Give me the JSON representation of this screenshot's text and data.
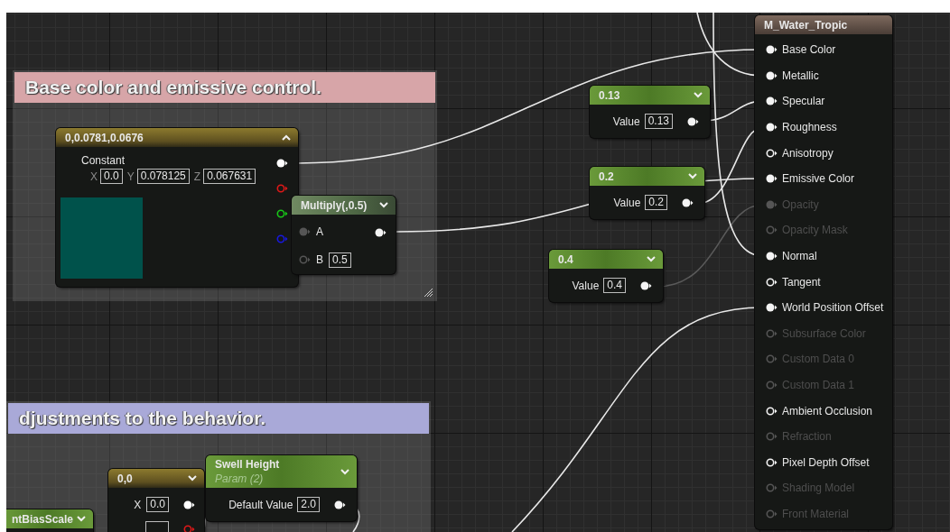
{
  "comments": [
    {
      "title": "Base color and emissive control.",
      "color": "#d7a5a8"
    },
    {
      "title": "djustments to the behavior.",
      "color": "#a9a9d8"
    }
  ],
  "constant": {
    "title": "0,0.0781,0.0676",
    "expanded": true,
    "label": "Constant",
    "fields": [
      {
        "axis": "X",
        "value": "0.0"
      },
      {
        "axis": "Y",
        "value": "0.078125"
      },
      {
        "axis": "Z",
        "value": "0.067631"
      }
    ],
    "color": "#00524b",
    "outputs": [
      {
        "color": "#ffffff",
        "filled": true
      },
      {
        "color": "#e01818",
        "filled": false
      },
      {
        "color": "#18c818",
        "filled": false
      },
      {
        "color": "#1818e0",
        "filled": false
      }
    ]
  },
  "multiply": {
    "title": "Multiply(,0.5)",
    "expanded": false,
    "inputs": [
      {
        "label": "A",
        "filled": true
      },
      {
        "label": "B",
        "value": "0.5",
        "filled": false
      }
    ]
  },
  "scalars": [
    {
      "title": "0.13",
      "expanded": false,
      "label": "Value",
      "value": "0.13"
    },
    {
      "title": "0.2",
      "expanded": false,
      "label": "Value",
      "value": "0.2"
    },
    {
      "title": "0.4",
      "expanded": false,
      "label": "Value",
      "value": "0.4"
    }
  ],
  "vector2": {
    "title": "0,0",
    "expanded": false,
    "rows": [
      {
        "axis": "X",
        "value": "0.0",
        "color": "#ffffff",
        "filled": true
      },
      {
        "color": "#e01818",
        "filled": false
      }
    ]
  },
  "param": {
    "title": "Swell Height",
    "subtitle": "Param (2)",
    "expanded": false,
    "label": "Default Value",
    "value": "2.0"
  },
  "cut_node": {
    "title": "ntBiasScale",
    "expanded": false
  },
  "material": {
    "title": "M_Water_Tropic",
    "inputs": [
      {
        "label": "Base Color",
        "filled": true,
        "disabled": false
      },
      {
        "label": "Metallic",
        "filled": true,
        "disabled": false
      },
      {
        "label": "Specular",
        "filled": true,
        "disabled": false
      },
      {
        "label": "Roughness",
        "filled": true,
        "disabled": false
      },
      {
        "label": "Anisotropy",
        "filled": false,
        "disabled": false
      },
      {
        "label": "Emissive Color",
        "filled": true,
        "disabled": false
      },
      {
        "label": "Opacity",
        "filled": true,
        "disabled": true
      },
      {
        "label": "Opacity Mask",
        "filled": false,
        "disabled": true
      },
      {
        "label": "Normal",
        "filled": true,
        "disabled": false
      },
      {
        "label": "Tangent",
        "filled": false,
        "disabled": false
      },
      {
        "label": "World Position Offset",
        "filled": true,
        "disabled": false
      },
      {
        "label": "Subsurface Color",
        "filled": false,
        "disabled": true
      },
      {
        "label": "Custom Data 0",
        "filled": false,
        "disabled": true
      },
      {
        "label": "Custom Data 1",
        "filled": false,
        "disabled": true
      },
      {
        "label": "Ambient Occlusion",
        "filled": false,
        "disabled": false
      },
      {
        "label": "Refraction",
        "filled": false,
        "disabled": true
      },
      {
        "label": "Pixel Depth Offset",
        "filled": false,
        "disabled": false
      },
      {
        "label": "Shading Model",
        "filled": false,
        "disabled": true
      },
      {
        "label": "Front Material",
        "filled": false,
        "disabled": true
      }
    ]
  }
}
